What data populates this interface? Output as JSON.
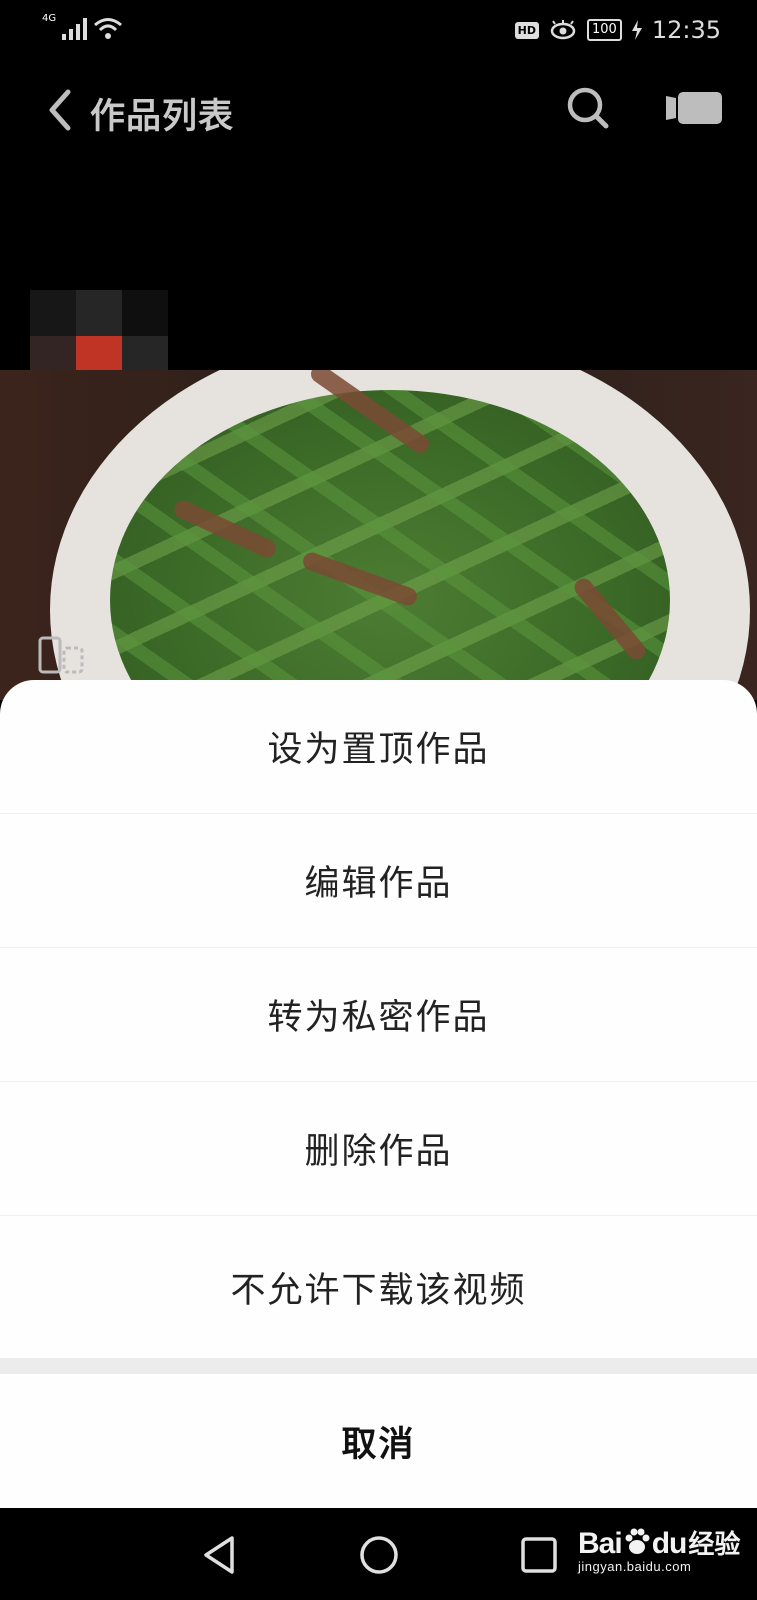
{
  "status_bar": {
    "network": "4G",
    "hd_badge": "HD",
    "battery": "100",
    "time": "12:35"
  },
  "nav": {
    "title": "作品列表",
    "icons": [
      "back-arrow-icon",
      "search-icon",
      "camera-icon"
    ]
  },
  "sheet": {
    "items": [
      {
        "label": "设为置顶作品"
      },
      {
        "label": "编辑作品"
      },
      {
        "label": "转为私密作品"
      },
      {
        "label": "删除作品"
      },
      {
        "label": "不允许下载该视频"
      }
    ],
    "cancel_label": "取消"
  },
  "system_nav": {
    "icons": [
      "back-triangle-icon",
      "home-circle-icon",
      "recents-square-icon"
    ]
  },
  "watermark": {
    "logo_text_a": "Bai",
    "logo_text_b": "du",
    "jingyan": "经验",
    "url": "jingyan.baidu.com"
  },
  "colors": {
    "background": "#000000",
    "sheet": "#fefefe",
    "divider": "#efefef",
    "gap": "#ececec"
  }
}
